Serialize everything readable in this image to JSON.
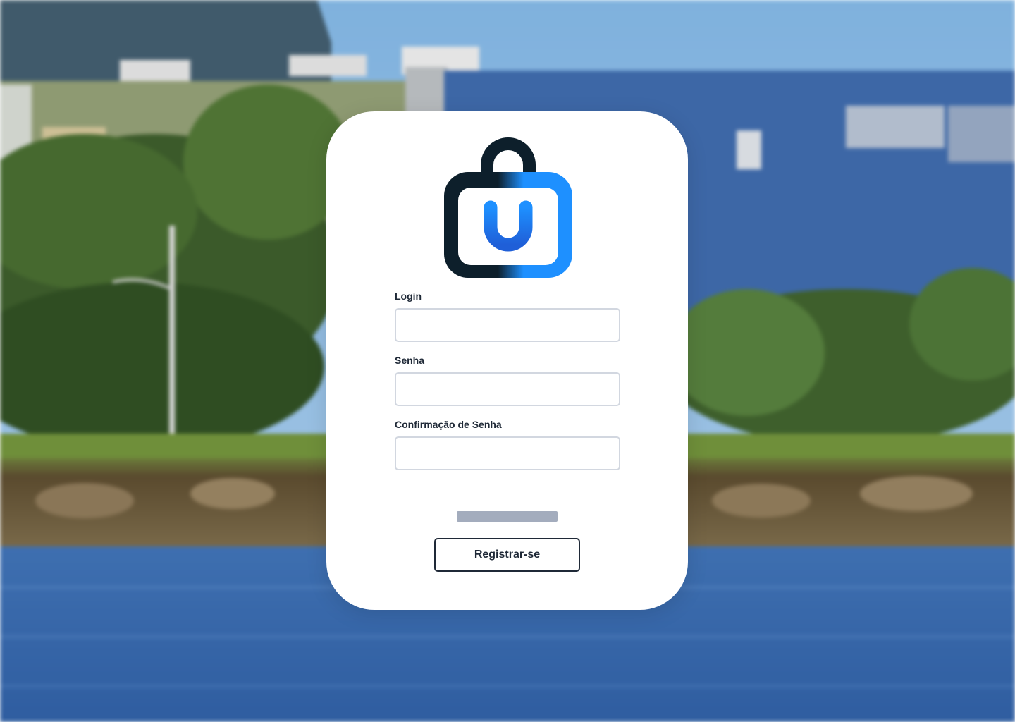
{
  "form": {
    "login_label": "Login",
    "login_value": "",
    "password_label": "Senha",
    "password_value": "",
    "confirm_label": "Confirmação de Senha",
    "confirm_value": "",
    "register_label": "Registrar-se"
  },
  "logo": {
    "letter": "U",
    "icon": "shopping-bag-icon"
  },
  "colors": {
    "brand_dark": "#0d1f2b",
    "brand_blue": "#1e90ff",
    "brand_blue_deep": "#1f6fe0",
    "input_border": "#d2d7e0",
    "text_dark": "#1f2937",
    "button_border": "#1f2937",
    "placeholder_bar": "#a3acbd"
  }
}
